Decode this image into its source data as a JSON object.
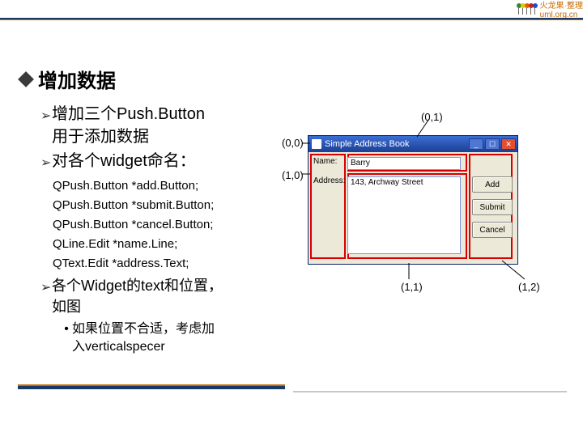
{
  "banner": {
    "brand": "火龙果·整理",
    "url": "uml.org.cn"
  },
  "head_colors": [
    "#2e8b2e",
    "#e8c800",
    "#e06000",
    "#c02030",
    "#2050c0"
  ],
  "bullets": {
    "h1": "增加数据",
    "s1a": "增加三个Push.Button",
    "s1b": "用于添加数据",
    "s2": "对各个widget命名：",
    "code": [
      "QPush.Button *add.Button;",
      "QPush.Button *submit.Button;",
      "QPush.Button *cancel.Button;",
      "QLine.Edit *name.Line;",
      " QText.Edit *address.Text;"
    ],
    "s3a": "各个Widget的text和位置，",
    "s3b": "如图",
    "s4a": "如果位置不合适，考虑加",
    "s4b": "入verticalspecer"
  },
  "diagram": {
    "coords": {
      "c01": "(0,1)",
      "c00": "(0,0)",
      "c10": "(1,0)",
      "c11": "(1,1)",
      "c12": "(1,2)"
    },
    "window": {
      "title": "Simple Address Book",
      "name_label": "Name:",
      "name_value": "Barry",
      "addr_label": "Address:",
      "addr_value": "143, Archway Street",
      "buttons": {
        "add": "Add",
        "submit": "Submit",
        "cancel": "Cancel"
      }
    }
  }
}
